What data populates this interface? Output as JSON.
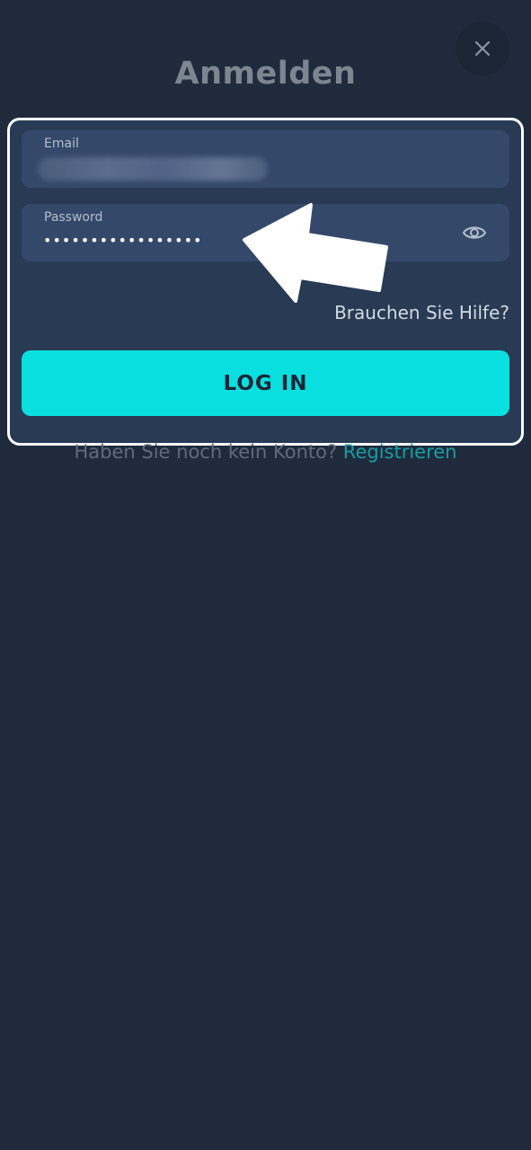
{
  "header": {
    "title": "Anmelden",
    "close_icon": "close-icon"
  },
  "form": {
    "email": {
      "label": "Email",
      "value_redacted": true
    },
    "password": {
      "label": "Password",
      "value": "•••••••••••••••••",
      "toggle_icon": "eye-icon"
    },
    "help_link": "Brauchen Sie Hilfe?",
    "login_button": "LOG IN"
  },
  "signup": {
    "prompt": "Haben Sie noch kein Konto?",
    "link": "Registrieren"
  },
  "colors": {
    "background": "#1f2b3c",
    "panel": "#283a54",
    "field": "#34496a",
    "button": "#0adfdf",
    "link": "#159da2",
    "highlight_border": "#ffffff"
  },
  "annotation": {
    "arrow_icon": "pointer-arrow-icon"
  }
}
